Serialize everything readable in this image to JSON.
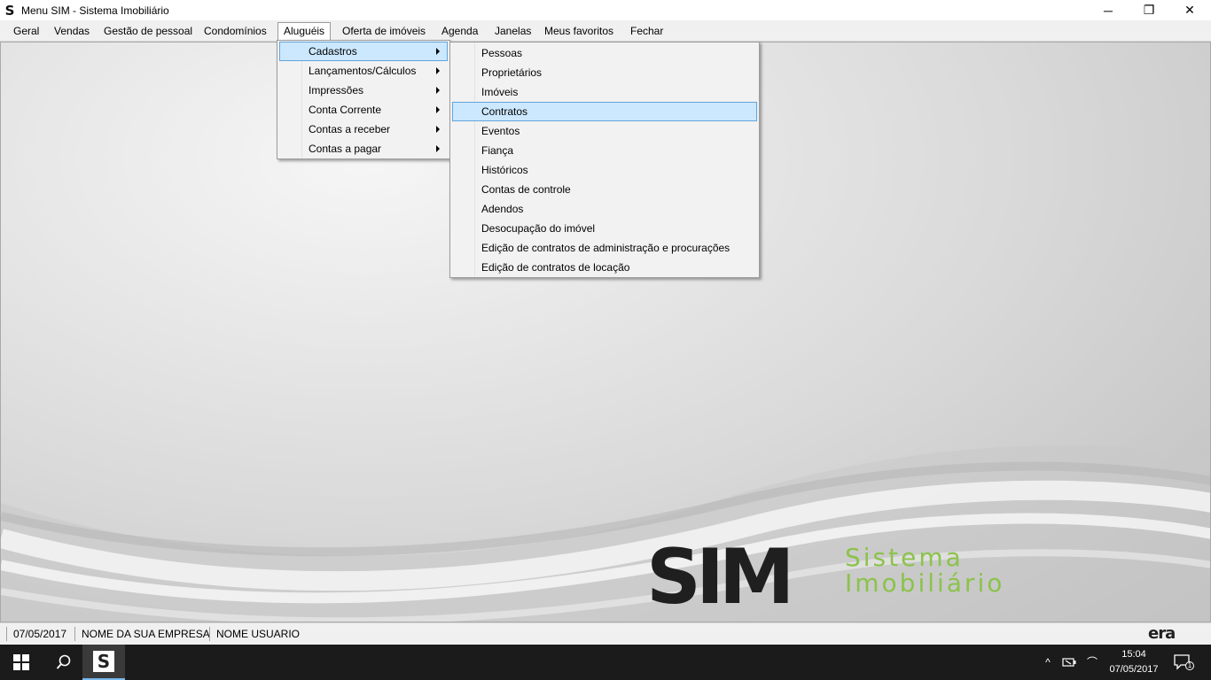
{
  "window": {
    "title": "Menu SIM - Sistema Imobiliário",
    "app_icon": "S",
    "minimize_glyph": "─",
    "maximize_glyph": "❐",
    "close_glyph": "✕"
  },
  "menubar": {
    "items": [
      "Geral",
      "Vendas",
      "Gestão de pessoal",
      "Condomínios",
      "Aluguéis",
      "Oferta de imóveis",
      "Agenda",
      "Janelas",
      "Meus favoritos",
      "Fechar"
    ],
    "active": "Aluguéis"
  },
  "menu_alugueis": {
    "items": [
      "Cadastros",
      "Lançamentos/Cálculos",
      "Impressões",
      "Conta Corrente",
      "Contas a receber",
      "Contas a pagar"
    ],
    "highlighted": "Cadastros"
  },
  "menu_cadastros": {
    "items": [
      "Pessoas",
      "Proprietários",
      "Imóveis",
      "Contratos",
      "Eventos",
      "Fiança",
      "Históricos",
      "Contas de controle",
      "Adendos",
      "Desocupação do imóvel",
      "Edição de contratos de administração e procurações",
      "Edição de contratos de locação"
    ],
    "highlighted": "Contratos"
  },
  "logo": {
    "brand": "SIM",
    "line1": "Sistema",
    "line2": "Imobiliário"
  },
  "statusbar": {
    "date": "07/05/2017",
    "company": "NOME DA SUA EMPRESA",
    "user": "NOME USUARIO",
    "vendor_logo": "era"
  },
  "taskbar": {
    "app_icon": "S",
    "tray_chevron": "^",
    "network_icon": "⌒",
    "time": "15:04",
    "date": "07/05/2017",
    "notification_count": "1"
  },
  "colors": {
    "highlight_fill": "#cce8ff",
    "highlight_border": "#5fa4dd",
    "logo_green": "#8bc34a",
    "taskbar": "#1b1b1b"
  }
}
